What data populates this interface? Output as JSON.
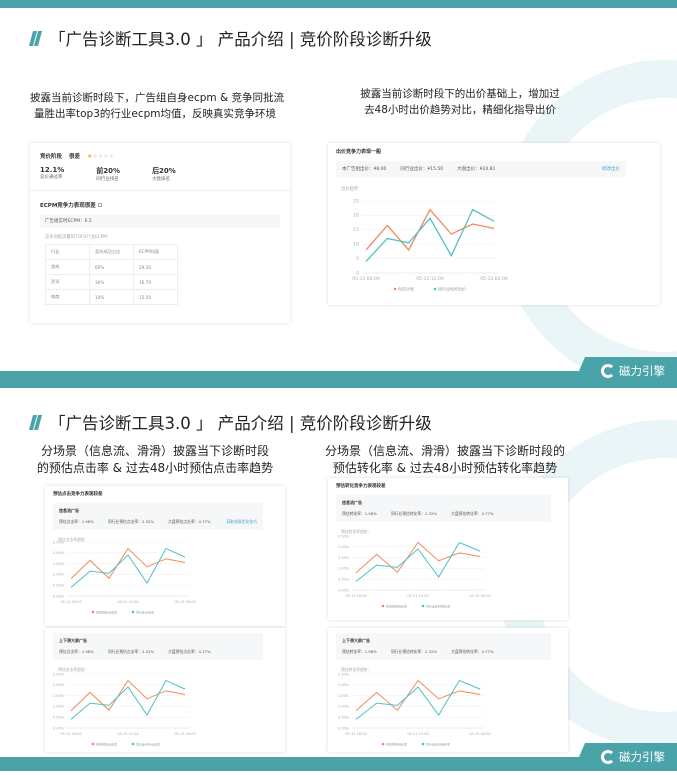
{
  "slides": [
    {
      "title": "「广告诊断工具3.0 」 产品介绍 | 竞价阶段诊断升级",
      "left_text": [
        "披露当前诊断时段下，广告组自身ecpm & 竞争同批流",
        "量胜出率top3的行业ecpm均值，反映真实竞争环境"
      ],
      "right_text": [
        "披露当前诊断时段下的出价基础上，增加过",
        "去48小时出价趋势对比，精细化指导出价"
      ],
      "logo": "磁力引擎"
    },
    {
      "title": "「广告诊断工具3.0 」 产品介绍 | 竞价阶段诊断升级",
      "left_text": [
        "分场景（信息流、滑滑）披露当下诊断时段",
        "的预估点击率 & 过去48小时预估点击率趋势"
      ],
      "right_text": [
        "分场景（信息流、滑滑）披露当下诊断时段的",
        "预估转化率 & 过去48小时预估转化率趋势"
      ],
      "logo": "磁力引擎"
    }
  ],
  "bid_card": {
    "stage": "竞价阶段",
    "rating": "很差",
    "star": "★",
    "stars_empty": "★★★★",
    "metrics": [
      {
        "value": "12.1%",
        "label": "竞价通过率"
      },
      {
        "value": "前20%",
        "label": "同行业排名"
      },
      {
        "value": "后20%",
        "label": "大盘排名"
      }
    ],
    "ecpm_title": "ECPM竞争力表现很差",
    "ecpm_now": "广告组实时ECPM：6.5",
    "top3_label": "竞争同批流量的TOP3行业ECPM：",
    "table": {
      "headers": [
        "行业",
        "竞价成功占比",
        "ECPM均值"
      ],
      "rows": [
        [
          "游戏",
          "60%",
          "29.20"
        ],
        [
          "资讯",
          "30%",
          "16.70"
        ],
        [
          "电商",
          "10%",
          "15.50"
        ]
      ]
    }
  },
  "price_card": {
    "title": "出价竞争力表现一般",
    "metrics": [
      "本广告组出价：¥8.00",
      "同行业出价：¥15.50",
      "大盘出价：¥24.81"
    ],
    "link": "修改出价",
    "trend_label": "出价趋势："
  },
  "ctr_card": {
    "title": "预估点击竞争力表现较差",
    "trend_label": "预估点击率趋势：",
    "scenes": [
      {
        "name": "信息流广告",
        "metrics": [
          "预估点击率：1.98%",
          "同行业预估点击率：2.32%",
          "大盘预估点击率：4.77%"
        ],
        "link": "获取创意优化技巧"
      },
      {
        "name": "上下滑大屏广告",
        "metrics": [
          "预估点击率：1.98%",
          "同行业预估点击率：2.32%",
          "大盘预估点击率：4.77%"
        ]
      }
    ]
  },
  "cvr_card": {
    "title": "预估转化竞争力表现较差",
    "trend_label": "预估转化率趋势：",
    "scenes": [
      {
        "name": "信息流广告",
        "metrics": [
          "预估转化率：1.98%",
          "同行业预估转化率：2.32%",
          "大盘预估转化率：4.77%"
        ]
      },
      {
        "name": "上下滑大屏广告",
        "metrics": [
          "预估转化率：1.98%",
          "同行业预估转化率：2.32%",
          "大盘预估转化率：4.77%"
        ]
      }
    ]
  },
  "colors": {
    "teal": "#4aa3a8",
    "orange": "#f08a5d",
    "line2": "#4fc1c6"
  },
  "chart_data": [
    {
      "type": "line",
      "x": [
        "05-11 00:00",
        "05-11 12:00",
        "05-12 00:00"
      ],
      "yticks": [
        "0",
        "5",
        "10",
        "15",
        "20",
        "25"
      ],
      "ylim": [
        0,
        25
      ],
      "series": [
        {
          "name": "你的计划",
          "values": [
            8,
            16.5,
            8,
            22,
            13.5,
            17,
            15.5
          ]
        },
        {
          "name": "同行业标杆出价",
          "values": [
            4,
            12,
            10.5,
            19,
            6,
            22,
            18
          ]
        }
      ]
    },
    {
      "type": "line",
      "x": [
        "05-11 00:00",
        "05-11 12:00",
        "05-12 00:00"
      ],
      "yticks": [
        "0.00%",
        "0.50%",
        "1.00%",
        "1.50%",
        "2.00%",
        "2.50%"
      ],
      "ylim": [
        0,
        2.5
      ],
      "series": [
        {
          "name": "你的预估点击率",
          "values": [
            0.8,
            1.65,
            0.82,
            2.2,
            1.35,
            1.72,
            1.55
          ]
        },
        {
          "name": "同行业点击率",
          "values": [
            0.4,
            1.15,
            1.05,
            1.9,
            0.6,
            2.2,
            1.8
          ]
        }
      ]
    },
    {
      "type": "line",
      "x": [
        "05-11 00:00",
        "05-11 12:00",
        "05-12 00:00"
      ],
      "yticks": [
        "0.00%",
        "0.50%",
        "1.00%",
        "1.50%",
        "2.00%",
        "2.50%"
      ],
      "ylim": [
        0,
        2.5
      ],
      "series": [
        {
          "name": "你的预估点击率",
          "values": [
            0.8,
            1.65,
            0.82,
            2.2,
            1.35,
            1.72,
            1.55
          ]
        },
        {
          "name": "同行业标杆点击率",
          "values": [
            0.4,
            1.15,
            1.05,
            1.9,
            0.6,
            2.2,
            1.8
          ]
        }
      ]
    },
    {
      "type": "line",
      "x": [
        "05-11 00:00",
        "05-11 12:00",
        "05-12 00:00"
      ],
      "yticks": [
        "0.00%",
        "0.50%",
        "1.00%",
        "1.50%",
        "2.00%",
        "2.50%"
      ],
      "ylim": [
        0,
        2.5
      ],
      "series": [
        {
          "name": "你的预估转化率",
          "values": [
            0.8,
            1.65,
            0.82,
            2.2,
            1.35,
            1.72,
            1.55
          ]
        },
        {
          "name": "同行业标杆转化率",
          "values": [
            0.4,
            1.15,
            1.05,
            1.9,
            0.6,
            2.2,
            1.8
          ]
        }
      ]
    },
    {
      "type": "line",
      "x": [
        "05-11 00:00",
        "05-11 12:00",
        "05-12 00:00"
      ],
      "yticks": [
        "0.00%",
        "0.50%",
        "1.00%",
        "1.50%",
        "2.00%",
        "2.50%"
      ],
      "ylim": [
        0,
        2.5
      ],
      "series": [
        {
          "name": "你的预估转化率",
          "values": [
            0.8,
            1.65,
            0.82,
            2.2,
            1.35,
            1.72,
            1.55
          ]
        },
        {
          "name": "同行业标杆转化率",
          "values": [
            0.4,
            1.15,
            1.05,
            1.9,
            0.6,
            2.2,
            1.8
          ]
        }
      ]
    }
  ]
}
